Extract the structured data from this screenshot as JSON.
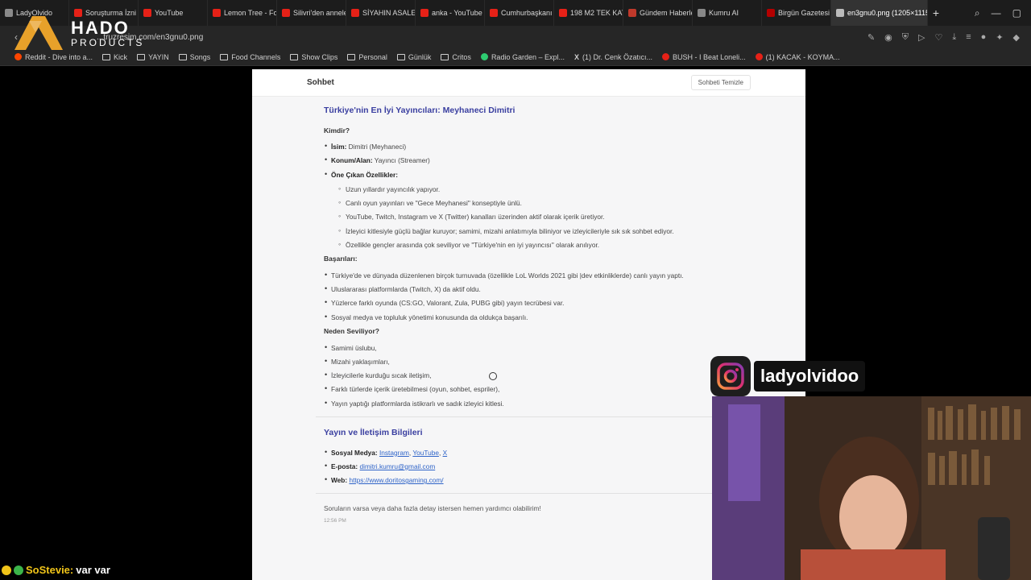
{
  "tabs": [
    {
      "label": "LadyOlvido",
      "color": "#8a8a8a"
    },
    {
      "label": "Soruşturma İzni Ç",
      "color": "#e62117"
    },
    {
      "label": "YouTube",
      "color": "#e62117"
    },
    {
      "label": "Lemon Tree - Foo",
      "color": "#e62117"
    },
    {
      "label": "Silivri'den annele",
      "color": "#e62117"
    },
    {
      "label": "SİYAHIN ASALETİ",
      "color": "#e62117"
    },
    {
      "label": "anka - YouTube",
      "color": "#e62117"
    },
    {
      "label": "Cumhurbaşkanı E",
      "color": "#e62117"
    },
    {
      "label": "198 M2 TEK KAT",
      "color": "#e62117"
    },
    {
      "label": "Gündem Haberle",
      "color": "#c0392b"
    },
    {
      "label": "Kumru AI",
      "color": "#888888"
    },
    {
      "label": "Birgün Gazetesi |",
      "color": "#b40000"
    },
    {
      "label": "en3gnu0.png (1205×1115",
      "color": "#bbbbbb",
      "active": true
    }
  ],
  "address": {
    "url": "...truzresim.com/en3gnu0.png"
  },
  "bookmarks": [
    {
      "label": "Reddit - Dive into a...",
      "type": "dot",
      "color": "#ff4500"
    },
    {
      "label": "Kick",
      "type": "folder"
    },
    {
      "label": "YAYIN",
      "type": "folder"
    },
    {
      "label": "Songs",
      "type": "folder"
    },
    {
      "label": "Food Channels",
      "type": "folder"
    },
    {
      "label": "Show Clips",
      "type": "folder"
    },
    {
      "label": "Personal",
      "type": "folder"
    },
    {
      "label": "Günlük",
      "type": "folder"
    },
    {
      "label": "Critos",
      "type": "folder"
    },
    {
      "label": "Radio Garden – Expl...",
      "type": "dot",
      "color": "#2ecc71"
    },
    {
      "label": "(1) Dr. Cenk Özatıcı...",
      "type": "x"
    },
    {
      "label": "BUSH - I Beat Loneli...",
      "type": "dot",
      "color": "#e62117"
    },
    {
      "label": "(1) KACAK - KOYMA...",
      "type": "dot",
      "color": "#e62117"
    }
  ],
  "logo": {
    "title": "HADO",
    "sub": "PRODUCTS"
  },
  "page": {
    "title": "Sohbet",
    "clear_label": "Sohbeti Temizle",
    "heading": "Türkiye'nin En İyi Yayıncıları: Meyhaneci Dimitri",
    "who_heading": "Kimdir?",
    "name_key": "İsim:",
    "name_val": " Dimitri (Meyhaneci)",
    "field_key": "Konum/Alan:",
    "field_val": " Yayıncı (Streamer)",
    "features_key": "Öne Çıkan Özellikler:",
    "features": [
      "Uzun yıllardır yayıncılık yapıyor.",
      "Canlı oyun yayınları ve \"Gece Meyhanesi\" konseptiyle ünlü.",
      "YouTube, Twitch, Instagram ve X (Twitter) kanalları üzerinden aktif olarak içerik üretiyor.",
      "İzleyici kitlesiyle güçlü bağlar kuruyor; samimi, mizahi anlatımıyla biliniyor ve izleyicileriyle sık sık sohbet ediyor.",
      "Özellikle gençler arasında çok seviliyor ve \"Türkiye'nin en iyi yayıncısı\" olarak anılıyor."
    ],
    "success_heading": "Başarıları:",
    "successes": [
      "Türkiye'de ve dünyada düzenlenen birçok turnuvada (özellikle LoL Worlds 2021 gibi |dev etkinliklerde) canlı yayın yaptı.",
      "Uluslararası platformlarda (Twitch, X) da aktif oldu.",
      "Yüzlerce farklı oyunda (CS:GO, Valorant, Zula, PUBG gibi) yayın tecrübesi var.",
      "Sosyal medya ve topluluk yönetimi konusunda da oldukça başarılı."
    ],
    "why_heading": "Neden Seviliyor?",
    "reasons": [
      "Samimi üslubu,",
      "Mizahi yaklaşımları,",
      "İzleyicilerle kurduğu sıcak iletişim,",
      "Farklı türlerde içerik üretebilmesi (oyun, sohbet, espriler),",
      "Yayın yaptığı platformlarda istikrarlı ve sadık izleyici kitlesi."
    ],
    "contact_heading": "Yayın ve İletişim Bilgileri",
    "social_key": "Sosyal Medya:",
    "social_links": [
      "Instagram",
      "YouTube",
      "X"
    ],
    "email_key": "E-posta:",
    "email_val": "dimitri.kumru@gmail.com",
    "web_key": "Web:",
    "web_val": "https://www.doritosgaming.com/",
    "closing": "Soruların varsa veya daha fazla detay istersen hemen yardımcı olabilirim!",
    "time": "12:56 PM"
  },
  "overlay": {
    "instagram_handle": "ladyolvidoo",
    "chat_user": "SoStevie:",
    "chat_msg": "var var"
  }
}
